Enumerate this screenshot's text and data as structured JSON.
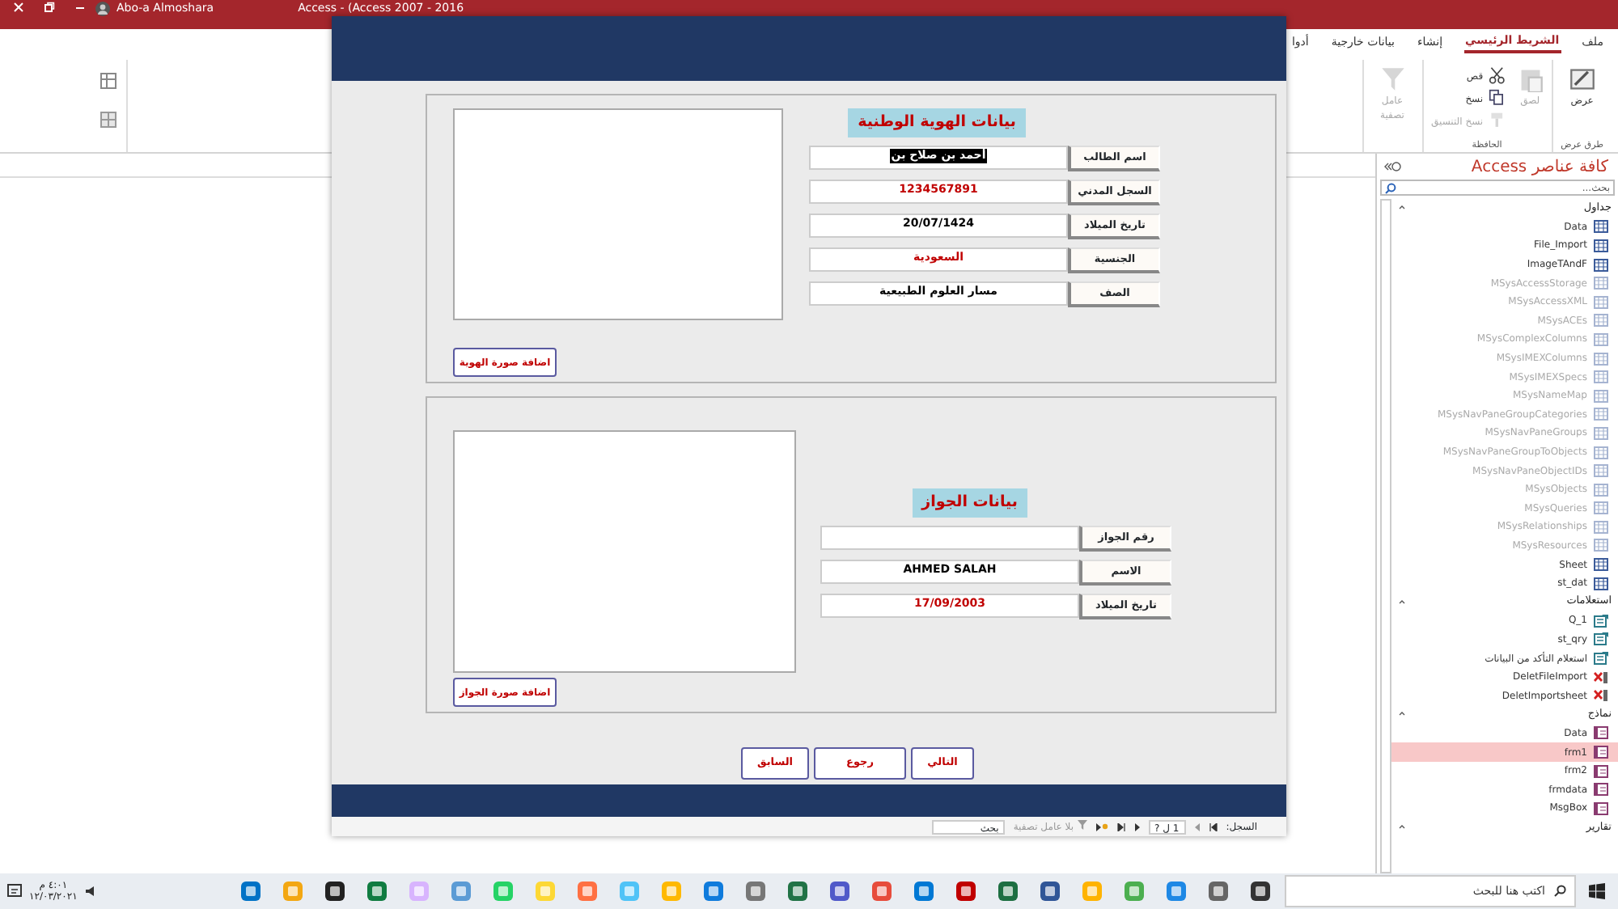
{
  "title_bar": {
    "user": "Abo-a Almoshara",
    "title": "Access - (Access 2007 - 2016"
  },
  "ribbon": {
    "tabs": [
      {
        "label": "ملف",
        "selected": false
      },
      {
        "label": "الشريط الرئيسي",
        "selected": true
      },
      {
        "label": "إنشاء",
        "selected": false
      },
      {
        "label": "بيانات خارجية",
        "selected": false
      },
      {
        "label": "أدوا",
        "selected": false
      }
    ],
    "groups": [
      {
        "label": "طرق عرض",
        "buttons": [
          {
            "label": "عرض",
            "kind": "view",
            "disabled": false
          }
        ]
      },
      {
        "label": "الحافظة",
        "buttons": [
          {
            "label": "لصق",
            "kind": "paste",
            "disabled": true
          },
          {
            "label": "قص",
            "kind": "cut",
            "disabled": false
          },
          {
            "label": "نسخ",
            "kind": "copy",
            "disabled": false
          },
          {
            "label": "نسخ التنسيق",
            "kind": "brush",
            "disabled": true
          }
        ]
      },
      {
        "buttons": [
          {
            "label": "عامل تصفية",
            "kind": "filter",
            "disabled": true
          }
        ]
      }
    ]
  },
  "form": {
    "sections": [
      {
        "title": "بيانات الهوية الوطنية",
        "button": "اضافة صورة الهوية",
        "fields": [
          {
            "label": "اسم الطالب",
            "value": "أحمد بن صلاح بن",
            "color": "#000000",
            "highlighted": true
          },
          {
            "label": "السجل المدني",
            "value": "1234567891",
            "color": "#c00000",
            "highlighted": false
          },
          {
            "label": "تاريخ الميلاد",
            "value": "20/07/1424",
            "color": "#000000",
            "highlighted": false
          },
          {
            "label": "الجنسية",
            "value": "السعودية",
            "color": "#c00000",
            "highlighted": false
          },
          {
            "label": "الصف",
            "value": "مسار العلوم الطبيعية",
            "color": "#000000",
            "highlighted": false
          }
        ]
      },
      {
        "title": "بيانات الجواز",
        "button": "اضافة صورة الجواز",
        "fields": [
          {
            "label": "رقم الجواز"
          },
          {
            "label": "الاسم",
            "value": "AHMED SALAH",
            "color": "#000000",
            "highlighted": false
          },
          {
            "label": "تاريخ الميلاد",
            "value": "17/09/2003",
            "color": "#c00000",
            "highlighted": false
          }
        ]
      }
    ],
    "nav_buttons": [
      "التالي",
      "رجوع",
      "السابق"
    ]
  },
  "record_nav": {
    "label": "السجل:",
    "position": "1 ل ?",
    "filter": "بلا عامل تصفية",
    "search": "بحث"
  },
  "nav_pane": {
    "title": "كافة عناصر Access",
    "search_placeholder": "بحث...",
    "groups": [
      {
        "label": "جداول",
        "items": [
          {
            "name": "Data",
            "kind": "table",
            "system": false,
            "selected": false
          },
          {
            "name": "File_Import",
            "kind": "table",
            "system": false,
            "selected": false
          },
          {
            "name": "ImageTAndF",
            "kind": "table",
            "system": false,
            "selected": false
          },
          {
            "name": "MSysAccessStorage",
            "kind": "table",
            "system": true,
            "selected": false
          },
          {
            "name": "MSysAccessXML",
            "kind": "table",
            "system": true,
            "selected": false
          },
          {
            "name": "MSysACEs",
            "kind": "table",
            "system": true,
            "selected": false
          },
          {
            "name": "MSysComplexColumns",
            "kind": "table",
            "system": true,
            "selected": false
          },
          {
            "name": "MSysIMEXColumns",
            "kind": "table",
            "system": true,
            "selected": false
          },
          {
            "name": "MSysIMEXSpecs",
            "kind": "table",
            "system": true,
            "selected": false
          },
          {
            "name": "MSysNameMap",
            "kind": "table",
            "system": true,
            "selected": false
          },
          {
            "name": "MSysNavPaneGroupCategories",
            "kind": "table",
            "system": true,
            "selected": false
          },
          {
            "name": "MSysNavPaneGroups",
            "kind": "table",
            "system": true,
            "selected": false
          },
          {
            "name": "MSysNavPaneGroupToObjects",
            "kind": "table",
            "system": true,
            "selected": false
          },
          {
            "name": "MSysNavPaneObjectIDs",
            "kind": "table",
            "system": true,
            "selected": false
          },
          {
            "name": "MSysObjects",
            "kind": "table",
            "system": true,
            "selected": false
          },
          {
            "name": "MSysQueries",
            "kind": "table",
            "system": true,
            "selected": false
          },
          {
            "name": "MSysRelationships",
            "kind": "table",
            "system": true,
            "selected": false
          },
          {
            "name": "MSysResources",
            "kind": "table",
            "system": true,
            "selected": false
          },
          {
            "name": "Sheet",
            "kind": "table",
            "system": false,
            "selected": false
          },
          {
            "name": "st_dat",
            "kind": "table",
            "system": false,
            "selected": false
          }
        ]
      },
      {
        "label": "استعلامات",
        "items": [
          {
            "name": "Q_1",
            "kind": "query",
            "system": false,
            "selected": false
          },
          {
            "name": "st_qry",
            "kind": "query",
            "system": false,
            "selected": false
          },
          {
            "name": "استعلام التأكد من البيانات",
            "kind": "query",
            "system": false,
            "selected": false
          },
          {
            "name": "DeletFileImport",
            "kind": "delete",
            "system": false,
            "selected": false
          },
          {
            "name": "DeletImportsheet",
            "kind": "delete",
            "system": false,
            "selected": false
          }
        ]
      },
      {
        "label": "نماذج",
        "items": [
          {
            "name": "Data",
            "kind": "form",
            "system": false,
            "selected": false
          },
          {
            "name": "frm1",
            "kind": "form",
            "system": false,
            "selected": true
          },
          {
            "name": "frm2",
            "kind": "form",
            "system": false,
            "selected": false
          },
          {
            "name": "frmdata",
            "kind": "form",
            "system": false,
            "selected": false
          },
          {
            "name": "MsgBox",
            "kind": "form",
            "system": false,
            "selected": false
          }
        ]
      },
      {
        "label": "تقارير"
      }
    ]
  },
  "taskbar": {
    "search_placeholder": "اكتب هنا للبحث",
    "time": "٤:٠١ م",
    "date": "١٢/٠٣/٢٠٢١"
  }
}
